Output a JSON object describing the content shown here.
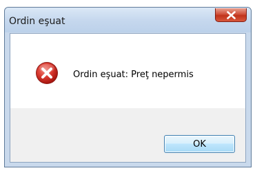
{
  "window": {
    "title": "Ordin eşuat"
  },
  "dialog": {
    "icon": "error-icon",
    "message": "Ordin eşuat: Preţ nepermis",
    "ok_label": "OK"
  },
  "colors": {
    "titlebar": "#c6d8ee",
    "close_button": "#c0331b",
    "error_icon": "#c2221d",
    "button_border": "#3c7fb1"
  }
}
